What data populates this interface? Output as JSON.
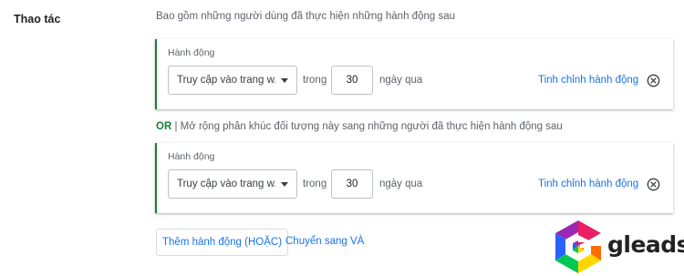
{
  "section": {
    "label": "Thao tác",
    "description": "Bao gồm những người dùng đã thực hiện những hành động sau"
  },
  "conditions": [
    {
      "title": "Hành động",
      "action_value": "Truy cập vào trang w...",
      "in_label": "trong",
      "days_value": "30",
      "days_label": "ngày qua",
      "refine_label": "Tinh chỉnh hành động",
      "remove_icon": "close-circle-icon"
    },
    {
      "title": "Hành động",
      "action_value": "Truy cập vào trang w...",
      "in_label": "trong",
      "days_value": "30",
      "days_label": "ngày qua",
      "refine_label": "Tinh chỉnh hành động",
      "remove_icon": "close-circle-icon"
    }
  ],
  "or_separator": {
    "keyword": "OR",
    "text": " | Mở rộng phân khúc đối tượng này sang những người đã thực hiện hành động sau"
  },
  "footer": {
    "add_or_label": "Thêm hành động (HOẶC)",
    "switch_and_label": "Chuyển sang VÀ"
  },
  "watermark": {
    "text": "gleads"
  },
  "colors": {
    "accent_green": "#188038",
    "link_blue": "#1a73e8"
  }
}
